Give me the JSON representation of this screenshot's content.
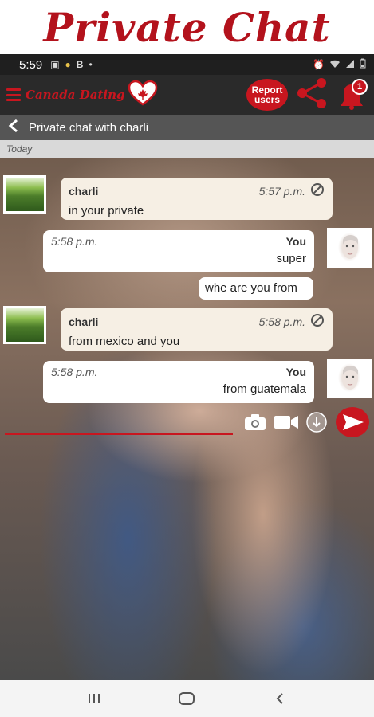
{
  "promo": {
    "title": "Private Chat"
  },
  "status_bar": {
    "time": "5:59",
    "letter": "B"
  },
  "app_bar": {
    "brand_name": "Canada Dating",
    "report_label_line1": "Report",
    "report_label_line2": "users",
    "notification_count": "1"
  },
  "chat_header": {
    "title": "Private chat with charli"
  },
  "date_divider": "Today",
  "messages": [
    {
      "sender": "charli",
      "time": "5:57 p.m.",
      "text": "in your private",
      "direction": "in"
    },
    {
      "sender": "You",
      "time": "5:58 p.m.",
      "text": "super",
      "direction": "out"
    },
    {
      "sender": "",
      "time": "",
      "text": "whe are you from",
      "direction": "out"
    },
    {
      "sender": "charli",
      "time": "5:58 p.m.",
      "text": "from mexico and you",
      "direction": "in"
    },
    {
      "sender": "You",
      "time": "5:58 p.m.",
      "text": "from guatemala",
      "direction": "out"
    }
  ],
  "composer": {
    "placeholder": ""
  },
  "colors": {
    "accent": "#c8161f",
    "incoming_bubble": "#f6efe4",
    "outgoing_bubble": "#ffffff",
    "chat_header": "#555555",
    "app_bar": "#2a2a2a"
  },
  "icons": [
    "hamburger-icon",
    "heart-logo-icon",
    "share-icon",
    "bell-icon",
    "back-icon",
    "blocked-icon",
    "camera-icon",
    "video-icon",
    "attach-icon",
    "send-icon",
    "nav-recents-icon",
    "nav-home-icon",
    "nav-back-icon"
  ]
}
